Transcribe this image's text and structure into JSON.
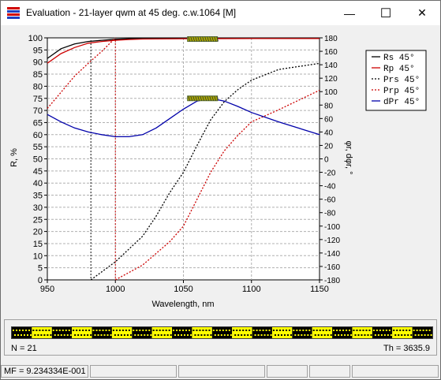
{
  "window": {
    "title": "Evaluation - 21-layer qwm at 45 deg. c.w.1064 [M]",
    "minimize_glyph": "—",
    "maximize_glyph": "☐",
    "close_glyph": "✕"
  },
  "chart_data": {
    "type": "line",
    "xlabel": "Wavelength, nm",
    "ylabel": "R, %",
    "y2label": "φr, dφr, °",
    "xlim": [
      950,
      1150
    ],
    "ylim": [
      0,
      100
    ],
    "y2lim": [
      -180,
      180
    ],
    "x_ticks": [
      "950",
      "1000",
      "1050",
      "1100",
      "1150"
    ],
    "y_ticks": [
      "0",
      "5",
      "10",
      "15",
      "20",
      "25",
      "30",
      "35",
      "40",
      "45",
      "50",
      "55",
      "60",
      "65",
      "70",
      "75",
      "80",
      "85",
      "90",
      "95",
      "100"
    ],
    "y2_ticks": [
      "-180",
      "-160",
      "-140",
      "-120",
      "-100",
      "-80",
      "-60",
      "-40",
      "-20",
      "0",
      "20",
      "40",
      "60",
      "80",
      "100",
      "120",
      "140",
      "160",
      "180"
    ],
    "grid": true,
    "legend_position": "right",
    "legend": [
      {
        "label": "Rs 45°",
        "color": "#000000",
        "dash": false
      },
      {
        "label": "Rp 45°",
        "color": "#cc0000",
        "dash": false
      },
      {
        "label": "Prs 45°",
        "color": "#000000",
        "dash": true
      },
      {
        "label": "Prp 45°",
        "color": "#cc0000",
        "dash": true
      },
      {
        "label": "dPr 45°",
        "color": "#0000aa",
        "dash": false
      }
    ],
    "series": [
      {
        "name": "Rs 45°",
        "axis": "left",
        "color": "#000000",
        "dash": false,
        "x": [
          950,
          960,
          970,
          980,
          990,
          1000,
          1010,
          1020,
          1050,
          1100,
          1150
        ],
        "y": [
          91.5,
          95.5,
          97.5,
          98.5,
          99.0,
          99.4,
          99.6,
          99.7,
          99.85,
          99.85,
          99.85
        ]
      },
      {
        "name": "Rp 45°",
        "axis": "left",
        "color": "#cc0000",
        "dash": false,
        "x": [
          950,
          960,
          970,
          980,
          990,
          1000,
          1010,
          1020,
          1050,
          1100,
          1150
        ],
        "y": [
          89.5,
          93.5,
          96.0,
          97.8,
          98.5,
          99.0,
          99.3,
          99.5,
          99.65,
          99.7,
          99.7
        ]
      },
      {
        "name": "Prs 45°",
        "axis": "right",
        "color": "#000000",
        "dash": true,
        "x": [
          982,
          982,
          1000,
          1020,
          1030,
          1040,
          1050,
          1060,
          1070,
          1080,
          1090,
          1100,
          1120,
          1150
        ],
        "y": [
          180,
          -180,
          -153,
          -115,
          -85,
          -50,
          -20,
          20,
          58,
          85,
          103,
          117,
          133,
          142
        ]
      },
      {
        "name": "Prp 45°",
        "axis": "right",
        "color": "#cc0000",
        "dash": true,
        "x": [
          950,
          960,
          970,
          980,
          990,
          1000,
          1000,
          1020,
          1040,
          1050,
          1060,
          1070,
          1080,
          1090,
          1100,
          1120,
          1150
        ],
        "y": [
          75,
          99,
          123,
          142,
          160,
          180,
          -180,
          -158,
          -123,
          -100,
          -60,
          -20,
          12,
          35,
          55,
          73,
          102
        ]
      },
      {
        "name": "dPr 45°",
        "axis": "right",
        "color": "#0000aa",
        "dash": false,
        "x": [
          950,
          960,
          970,
          980,
          990,
          1000,
          1010,
          1020,
          1030,
          1040,
          1050,
          1060,
          1070,
          1080,
          1090,
          1100,
          1120,
          1150
        ],
        "y": [
          66,
          55,
          46,
          40,
          36,
          33,
          33,
          36,
          46,
          60,
          74,
          86,
          90,
          86,
          78,
          69,
          55,
          36
        ]
      }
    ],
    "target_bands": [
      {
        "x": [
          1053,
          1075
        ],
        "y": 99.5
      },
      {
        "x": [
          1053,
          1075
        ],
        "y": 75
      }
    ],
    "markers": [
      {
        "x": 982,
        "color": "#000000"
      },
      {
        "x": 1000,
        "color": "#cc0000"
      }
    ]
  },
  "stripe": {
    "color_a": "#ffff00",
    "color_b": "#000000",
    "n_label": "N = 21",
    "th_label": "Th = 3635.9"
  },
  "status": {
    "mf_label": "MF = 9.234334E-001"
  }
}
